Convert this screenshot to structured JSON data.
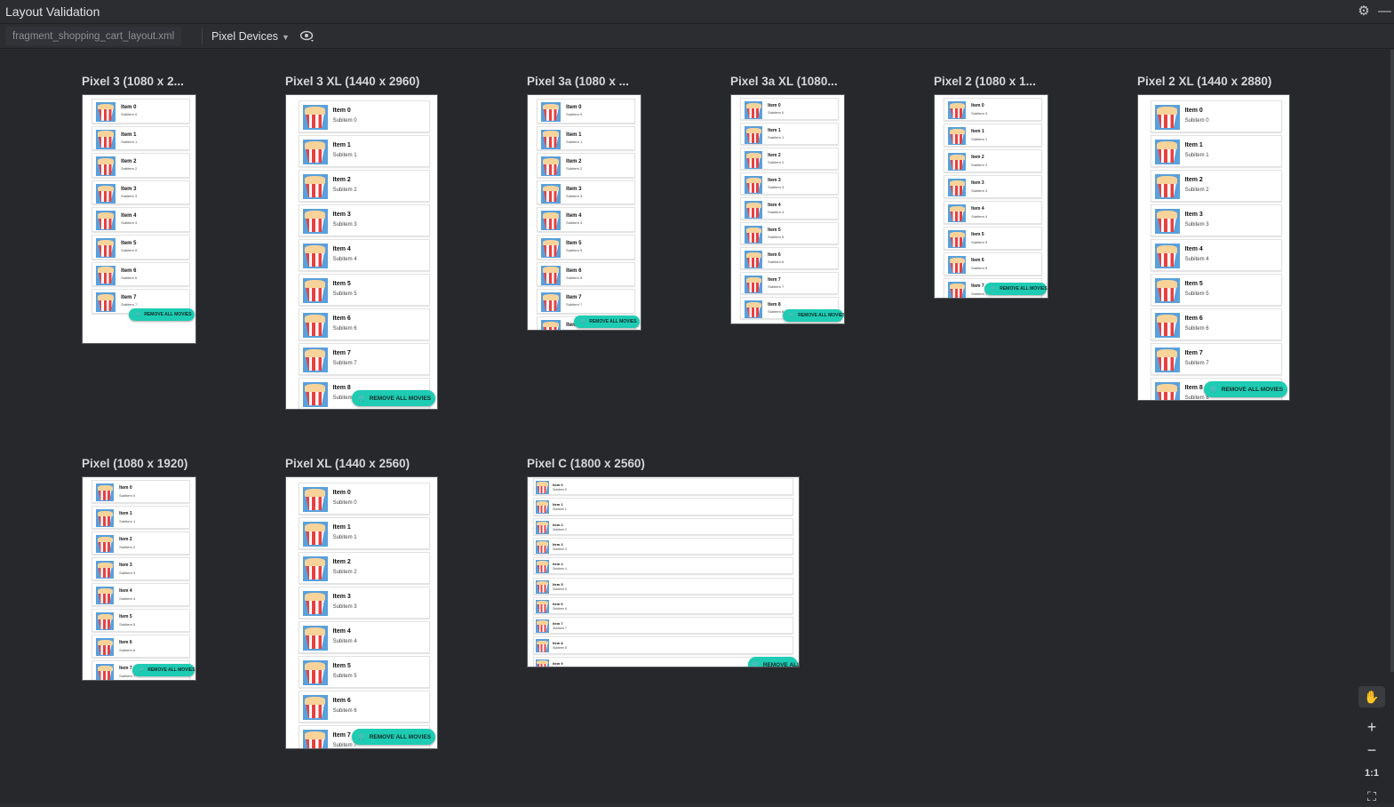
{
  "window": {
    "title": "Layout Validation"
  },
  "toolbar": {
    "file_tab": "fragment_shopping_cart_layout.xml",
    "device_dropdown": "Pixel Devices"
  },
  "icons": {
    "settings": "gear-icon",
    "minimize": "minimize-icon",
    "visibility": "eye-icon",
    "pan": "hand-icon",
    "zoom_in": "plus-icon",
    "zoom_out": "minus-icon",
    "fit": "fit-screen-icon"
  },
  "side_tools": {
    "zoom_in": "+",
    "zoom_out": "−",
    "actual_size": "1:1"
  },
  "colors": {
    "fab": "#1ecbb3",
    "thumb": "#5aa0db",
    "canvas": "#26282b"
  },
  "fab_label": "REMOVE ALL MOVIES",
  "previews": [
    {
      "label": "Pixel 3 (1080 x 2...",
      "items": [
        {
          "title": "Item 0",
          "subtitle": "Subitem 0"
        },
        {
          "title": "Item 1",
          "subtitle": "Subitem 1"
        },
        {
          "title": "Item 2",
          "subtitle": "Subitem 2"
        },
        {
          "title": "Item 3",
          "subtitle": "Subitem 3"
        },
        {
          "title": "Item 4",
          "subtitle": "Subitem 4"
        },
        {
          "title": "Item 5",
          "subtitle": "Subitem 5"
        },
        {
          "title": "Item 6",
          "subtitle": "Subitem 6"
        },
        {
          "title": "Item 7",
          "subtitle": "Subitem 7"
        }
      ]
    },
    {
      "label": "Pixel 3 XL (1440 x 2960)",
      "items": [
        {
          "title": "Item 0",
          "subtitle": "Subitem 0"
        },
        {
          "title": "Item 1",
          "subtitle": "Subitem 1"
        },
        {
          "title": "Item 2",
          "subtitle": "Subitem 2"
        },
        {
          "title": "Item 3",
          "subtitle": "Subitem 3"
        },
        {
          "title": "Item 4",
          "subtitle": "Subitem 4"
        },
        {
          "title": "Item 5",
          "subtitle": "Subitem 5"
        },
        {
          "title": "Item 6",
          "subtitle": "Subitem 6"
        },
        {
          "title": "Item 7",
          "subtitle": "Subitem 7"
        },
        {
          "title": "Item 8",
          "subtitle": "Subitem 8"
        }
      ]
    },
    {
      "label": "Pixel 3a (1080 x ...",
      "items": [
        {
          "title": "Item 0",
          "subtitle": "Subitem 0"
        },
        {
          "title": "Item 1",
          "subtitle": "Subitem 1"
        },
        {
          "title": "Item 2",
          "subtitle": "Subitem 2"
        },
        {
          "title": "Item 3",
          "subtitle": "Subitem 3"
        },
        {
          "title": "Item 4",
          "subtitle": "Subitem 4"
        },
        {
          "title": "Item 5",
          "subtitle": "Subitem 5"
        },
        {
          "title": "Item 6",
          "subtitle": "Subitem 6"
        },
        {
          "title": "Item 7",
          "subtitle": "Subitem 7"
        },
        {
          "title": "Item 8",
          "subtitle": "Subitem 8"
        }
      ]
    },
    {
      "label": "Pixel 3a XL (1080...",
      "items": [
        {
          "title": "Item 0",
          "subtitle": "Subitem 0"
        },
        {
          "title": "Item 1",
          "subtitle": "Subitem 1"
        },
        {
          "title": "Item 2",
          "subtitle": "Subitem 2"
        },
        {
          "title": "Item 3",
          "subtitle": "Subitem 3"
        },
        {
          "title": "Item 4",
          "subtitle": "Subitem 4"
        },
        {
          "title": "Item 5",
          "subtitle": "Subitem 5"
        },
        {
          "title": "Item 6",
          "subtitle": "Subitem 6"
        },
        {
          "title": "Item 7",
          "subtitle": "Subitem 7"
        },
        {
          "title": "Item 8",
          "subtitle": "Subitem 8"
        }
      ]
    },
    {
      "label": "Pixel 2 (1080 x 1...",
      "items": [
        {
          "title": "Item 0",
          "subtitle": "Subitem 0"
        },
        {
          "title": "Item 1",
          "subtitle": "Subitem 1"
        },
        {
          "title": "Item 2",
          "subtitle": "Subitem 2"
        },
        {
          "title": "Item 3",
          "subtitle": "Subitem 3"
        },
        {
          "title": "Item 4",
          "subtitle": "Subitem 4"
        },
        {
          "title": "Item 5",
          "subtitle": "Subitem 5"
        },
        {
          "title": "Item 6",
          "subtitle": "Subitem 6"
        },
        {
          "title": "Item 7",
          "subtitle": "Subitem 7"
        }
      ]
    },
    {
      "label": "Pixel 2 XL (1440 x 2880)",
      "items": [
        {
          "title": "Item 0",
          "subtitle": "Subitem 0"
        },
        {
          "title": "Item 1",
          "subtitle": "Subitem 1"
        },
        {
          "title": "Item 2",
          "subtitle": "Subitem 2"
        },
        {
          "title": "Item 3",
          "subtitle": "Subitem 3"
        },
        {
          "title": "Item 4",
          "subtitle": "Subitem 4"
        },
        {
          "title": "Item 5",
          "subtitle": "Subitem 5"
        },
        {
          "title": "Item 6",
          "subtitle": "Subitem 6"
        },
        {
          "title": "Item 7",
          "subtitle": "Subitem 7"
        },
        {
          "title": "Item 8",
          "subtitle": "Subitem 8"
        }
      ]
    },
    {
      "label": "Pixel (1080 x 1920)",
      "items": [
        {
          "title": "Item 0",
          "subtitle": "Subitem 0"
        },
        {
          "title": "Item 1",
          "subtitle": "Subitem 1"
        },
        {
          "title": "Item 2",
          "subtitle": "Subitem 2"
        },
        {
          "title": "Item 3",
          "subtitle": "Subitem 3"
        },
        {
          "title": "Item 4",
          "subtitle": "Subitem 4"
        },
        {
          "title": "Item 5",
          "subtitle": "Subitem 5"
        },
        {
          "title": "Item 6",
          "subtitle": "Subitem 6"
        },
        {
          "title": "Item 7",
          "subtitle": "Subitem 7"
        }
      ]
    },
    {
      "label": "Pixel XL (1440 x 2560)",
      "items": [
        {
          "title": "Item 0",
          "subtitle": "Subitem 0"
        },
        {
          "title": "Item 1",
          "subtitle": "Subitem 1"
        },
        {
          "title": "Item 2",
          "subtitle": "Subitem 2"
        },
        {
          "title": "Item 3",
          "subtitle": "Subitem 3"
        },
        {
          "title": "Item 4",
          "subtitle": "Subitem 4"
        },
        {
          "title": "Item 5",
          "subtitle": "Subitem 5"
        },
        {
          "title": "Item 6",
          "subtitle": "Subitem 6"
        },
        {
          "title": "Item 7",
          "subtitle": "Subitem 7"
        }
      ]
    },
    {
      "label": "Pixel C (1800 x 2560)",
      "items": [
        {
          "title": "Item 0",
          "subtitle": "Subitem 0"
        },
        {
          "title": "Item 1",
          "subtitle": "Subitem 1"
        },
        {
          "title": "Item 2",
          "subtitle": "Subitem 2"
        },
        {
          "title": "Item 3",
          "subtitle": "Subitem 3"
        },
        {
          "title": "Item 4",
          "subtitle": "Subitem 4"
        },
        {
          "title": "Item 5",
          "subtitle": "Subitem 5"
        },
        {
          "title": "Item 6",
          "subtitle": "Subitem 6"
        },
        {
          "title": "Item 7",
          "subtitle": "Subitem 7"
        },
        {
          "title": "Item 8",
          "subtitle": "Subitem 8"
        },
        {
          "title": "Item 9",
          "subtitle": "Subitem 9"
        }
      ]
    }
  ]
}
